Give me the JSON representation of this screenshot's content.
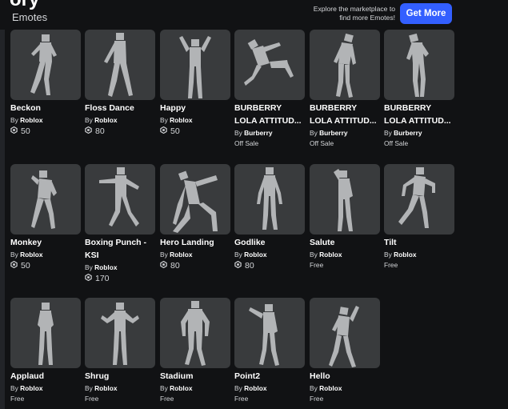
{
  "header": {
    "title_fragment": "ory",
    "section_title": "Emotes",
    "promo_line1": "Explore the marketplace to",
    "promo_line2": "find more Emotes!",
    "cta_label": "Get More"
  },
  "icons": {
    "currency": "robux-icon"
  },
  "colors": {
    "background": "#111214",
    "tile": "#393b3d",
    "accent": "#335fff"
  },
  "items": [
    {
      "name": "Beckon",
      "by": "By",
      "creator": "Roblox",
      "price": "50"
    },
    {
      "name": "Floss Dance",
      "by": "By",
      "creator": "Roblox",
      "price": "80"
    },
    {
      "name": "Happy",
      "by": "By",
      "creator": "Roblox",
      "price": "50"
    },
    {
      "name": "BURBERRY LOLA ATTITUD...",
      "by": "By",
      "creator": "Burberry",
      "status": "Off Sale"
    },
    {
      "name": "BURBERRY LOLA ATTITUD...",
      "by": "By",
      "creator": "Burberry",
      "status": "Off Sale"
    },
    {
      "name": "BURBERRY LOLA ATTITUD...",
      "by": "By",
      "creator": "Burberry",
      "status": "Off Sale"
    },
    {
      "name": "Monkey",
      "by": "By",
      "creator": "Roblox",
      "price": "50"
    },
    {
      "name": "Boxing Punch - KSI",
      "by": "By",
      "creator": "Roblox",
      "price": "170"
    },
    {
      "name": "Hero Landing",
      "by": "By",
      "creator": "Roblox",
      "price": "80"
    },
    {
      "name": "Godlike",
      "by": "By",
      "creator": "Roblox",
      "price": "80"
    },
    {
      "name": "Salute",
      "by": "By",
      "creator": "Roblox",
      "status": "Free"
    },
    {
      "name": "Tilt",
      "by": "By",
      "creator": "Roblox",
      "status": "Free"
    },
    {
      "name": "Applaud",
      "by": "By",
      "creator": "Roblox",
      "status": "Free"
    },
    {
      "name": "Shrug",
      "by": "By",
      "creator": "Roblox",
      "status": "Free"
    },
    {
      "name": "Stadium",
      "by": "By",
      "creator": "Roblox",
      "status": "Free"
    },
    {
      "name": "Point2",
      "by": "By",
      "creator": "Roblox",
      "status": "Free"
    },
    {
      "name": "Hello",
      "by": "By",
      "creator": "Roblox",
      "status": "Free"
    }
  ]
}
